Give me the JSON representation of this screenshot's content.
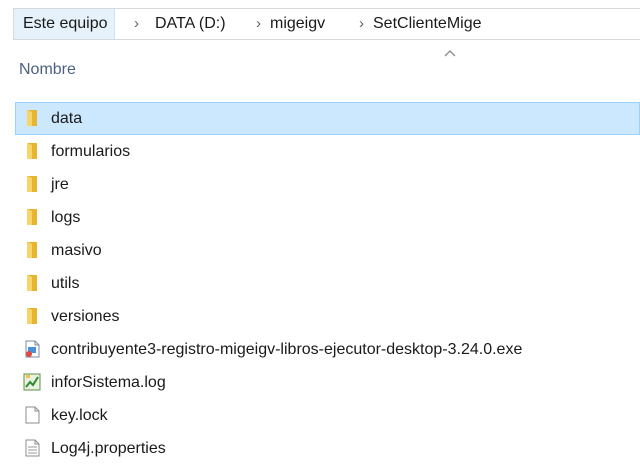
{
  "breadcrumb": {
    "items": [
      "Este equipo",
      "DATA (D:)",
      "migeigv",
      "SetClienteMige"
    ],
    "separator": "›"
  },
  "columns": {
    "name_header": "Nombre"
  },
  "colors": {
    "folder": "#f2c23b",
    "selection": "#cce8ff",
    "header_text": "#4d6082"
  },
  "files": [
    {
      "name": "data",
      "icon": "folder-icon",
      "selected": true
    },
    {
      "name": "formularios",
      "icon": "folder-icon"
    },
    {
      "name": "jre",
      "icon": "folder-icon"
    },
    {
      "name": "logs",
      "icon": "folder-icon"
    },
    {
      "name": "masivo",
      "icon": "folder-icon"
    },
    {
      "name": "utils",
      "icon": "folder-icon"
    },
    {
      "name": "versiones",
      "icon": "folder-icon"
    },
    {
      "name": "contribuyente3-registro-migeigv-libros-ejecutor-desktop-3.24.0.exe",
      "icon": "exe-icon"
    },
    {
      "name": "inforSistema.log",
      "icon": "log-file-icon"
    },
    {
      "name": "key.lock",
      "icon": "file-icon"
    },
    {
      "name": "Log4j.properties",
      "icon": "text-file-icon"
    }
  ]
}
